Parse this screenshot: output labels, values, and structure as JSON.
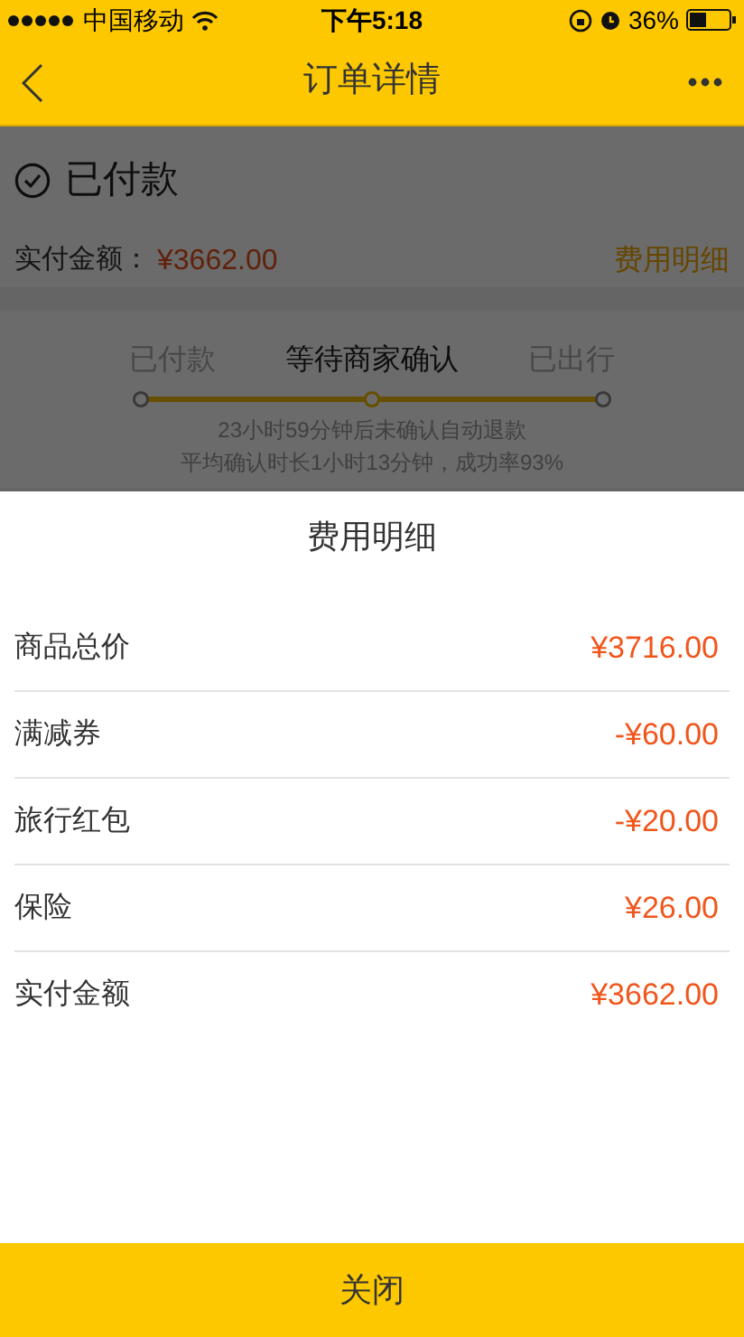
{
  "status_bar": {
    "carrier": "中国移动",
    "time": "下午5:18",
    "battery": "36%"
  },
  "nav": {
    "title": "订单详情"
  },
  "order": {
    "status": "已付款",
    "amount_label": "实付金额：",
    "amount": "¥3662.00",
    "detail_link": "费用明细"
  },
  "progress": {
    "steps": [
      {
        "label": "已付款",
        "selected": false
      },
      {
        "label": "等待商家确认",
        "selected": true
      },
      {
        "label": "已出行",
        "selected": false
      }
    ],
    "notes": [
      "23小时59分钟后未确认自动退款",
      "平均确认时长1小时13分钟，成功率93%"
    ]
  },
  "sheet": {
    "title": "费用明细",
    "rows": [
      {
        "label": "商品总价",
        "value": "¥3716.00"
      },
      {
        "label": "满减券",
        "value": "-¥60.00"
      },
      {
        "label": "旅行红包",
        "value": "-¥20.00"
      },
      {
        "label": "保险",
        "value": "¥26.00"
      },
      {
        "label": "实付金额",
        "value": "¥3662.00"
      }
    ],
    "close_button": "关闭"
  }
}
